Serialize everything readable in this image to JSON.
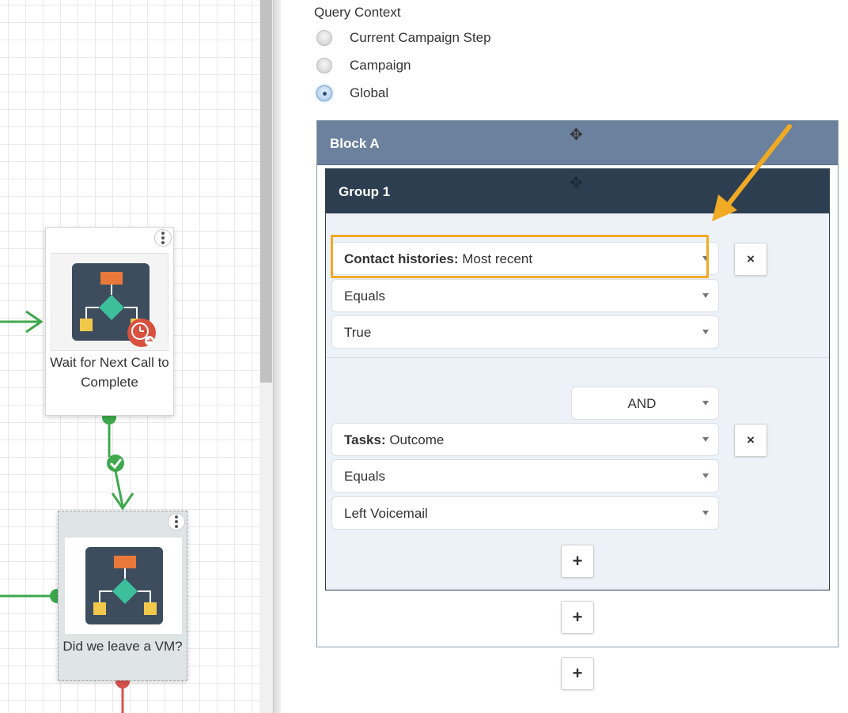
{
  "canvas": {
    "nodes": [
      {
        "label": "Wait for Next Call to Complete"
      },
      {
        "label": "Did we leave a VM?"
      }
    ]
  },
  "query_context": {
    "label": "Query Context",
    "options": [
      {
        "label": "Current Campaign Step",
        "checked": false
      },
      {
        "label": "Campaign",
        "checked": false
      },
      {
        "label": "Global",
        "checked": true
      }
    ]
  },
  "block": {
    "title": "Block A",
    "group": {
      "title": "Group 1",
      "conditions": [
        {
          "field_bold": "Contact histories:",
          "field_rest": " Most recent",
          "operator": "Equals",
          "value": "True",
          "remove_label": "×"
        },
        {
          "connector": "AND",
          "field_bold": "Tasks:",
          "field_rest": " Outcome",
          "operator": "Equals",
          "value": "Left Voicemail",
          "remove_label": "×"
        }
      ],
      "add_condition_label": "+"
    },
    "add_group_label": "+"
  },
  "add_block_label": "+",
  "colors": {
    "block_header": "#6b819d",
    "group_header": "#2d3e50",
    "highlight": "#f0aa24",
    "flow_green": "#3fa84d",
    "flow_red": "#d9534f"
  }
}
